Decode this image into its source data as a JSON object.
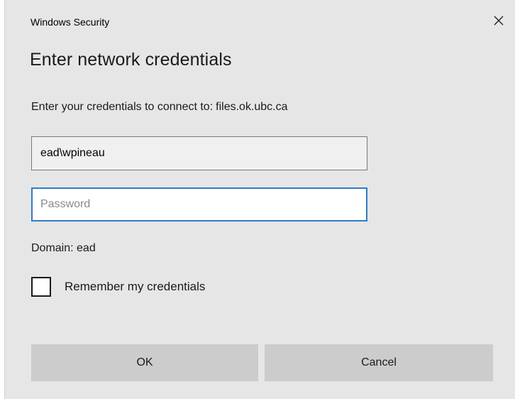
{
  "window": {
    "title": "Windows Security",
    "close_icon": "close-icon"
  },
  "dialog": {
    "heading": "Enter network credentials",
    "prompt_text": "Enter your credentials to connect to:",
    "host": "files.ok.ubc.ca"
  },
  "username": {
    "value": "ead\\wpineau"
  },
  "password": {
    "value": "",
    "placeholder": "Password"
  },
  "domain_label": "Domain: ead",
  "remember": {
    "label": "Remember my credentials",
    "checked": false
  },
  "buttons": {
    "ok_label": "OK",
    "cancel_label": "Cancel"
  },
  "colors": {
    "background": "#e6e6e6",
    "focus_border": "#2f7dc4",
    "button_bg": "#cccccc"
  }
}
